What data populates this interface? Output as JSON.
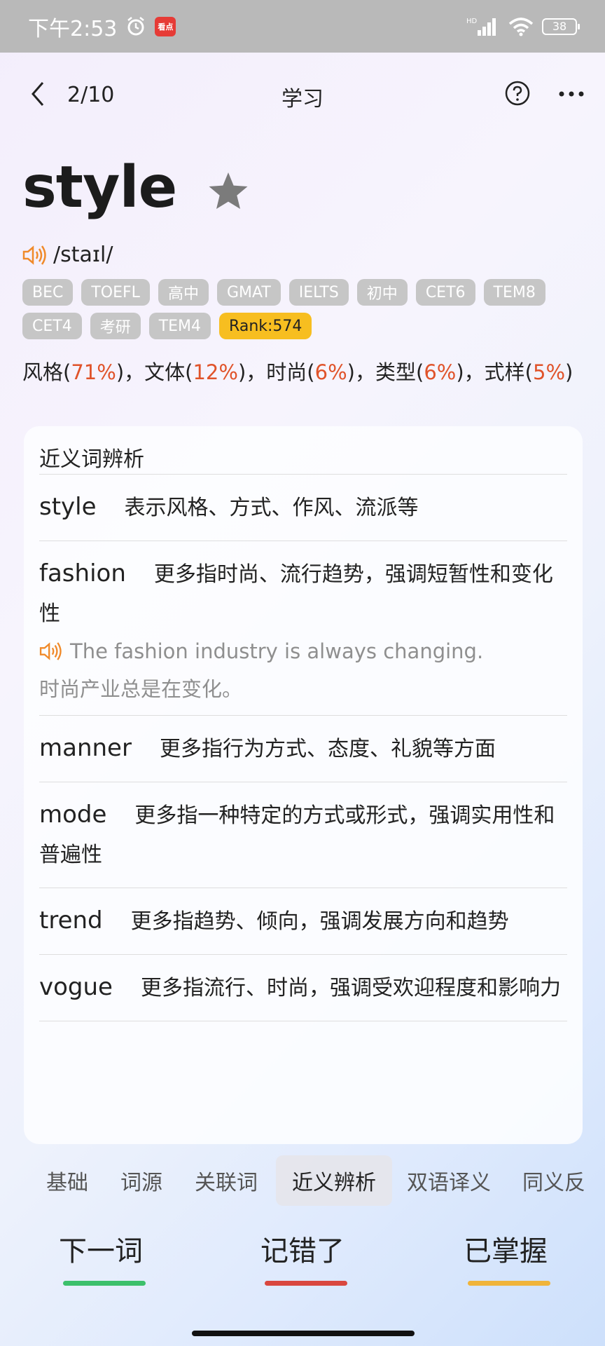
{
  "status_bar": {
    "time": "下午2:53",
    "news_badge": "看点",
    "network": "HD",
    "battery": "38"
  },
  "nav": {
    "progress": "2/10",
    "title": "学习"
  },
  "word": {
    "headword": "style",
    "phonetic": "/staɪl/",
    "tags": [
      "BEC",
      "TOEFL",
      "高中",
      "GMAT",
      "IELTS",
      "初中",
      "CET6",
      "TEM8",
      "CET4",
      "考研",
      "TEM4"
    ],
    "rank": "Rank:574",
    "meanings": [
      {
        "text": "风格",
        "pct": "71%"
      },
      {
        "text": "文体",
        "pct": "12%"
      },
      {
        "text": "时尚",
        "pct": "6%"
      },
      {
        "text": "类型",
        "pct": "6%"
      },
      {
        "text": "式样",
        "pct": "5%"
      }
    ]
  },
  "synonyms": {
    "title": "近义词辨析",
    "items": [
      {
        "word": "style",
        "desc": "表示风格、方式、作风、流派等"
      },
      {
        "word": "fashion",
        "desc": "更多指时尚、流行趋势，强调短暂性和变化性",
        "example_en": "The fashion industry is always changing.",
        "example_cn": "时尚产业总是在变化。"
      },
      {
        "word": "manner",
        "desc": "更多指行为方式、态度、礼貌等方面"
      },
      {
        "word": "mode",
        "desc": "更多指一种特定的方式或形式，强调实用性和普遍性"
      },
      {
        "word": "trend",
        "desc": "更多指趋势、倾向，强调发展方向和趋势"
      },
      {
        "word": "vogue",
        "desc": "更多指流行、时尚，强调受欢迎程度和影响力"
      }
    ]
  },
  "tabs": [
    "基础",
    "词源",
    "关联词",
    "近义辨析",
    "双语译义",
    "同义反"
  ],
  "active_tab": "近义辨析",
  "actions": {
    "next": {
      "label": "下一词",
      "color": "#3cc06b"
    },
    "wrong": {
      "label": "记错了",
      "color": "#d9473f"
    },
    "mastered": {
      "label": "已掌握",
      "color": "#f0b43a"
    }
  }
}
